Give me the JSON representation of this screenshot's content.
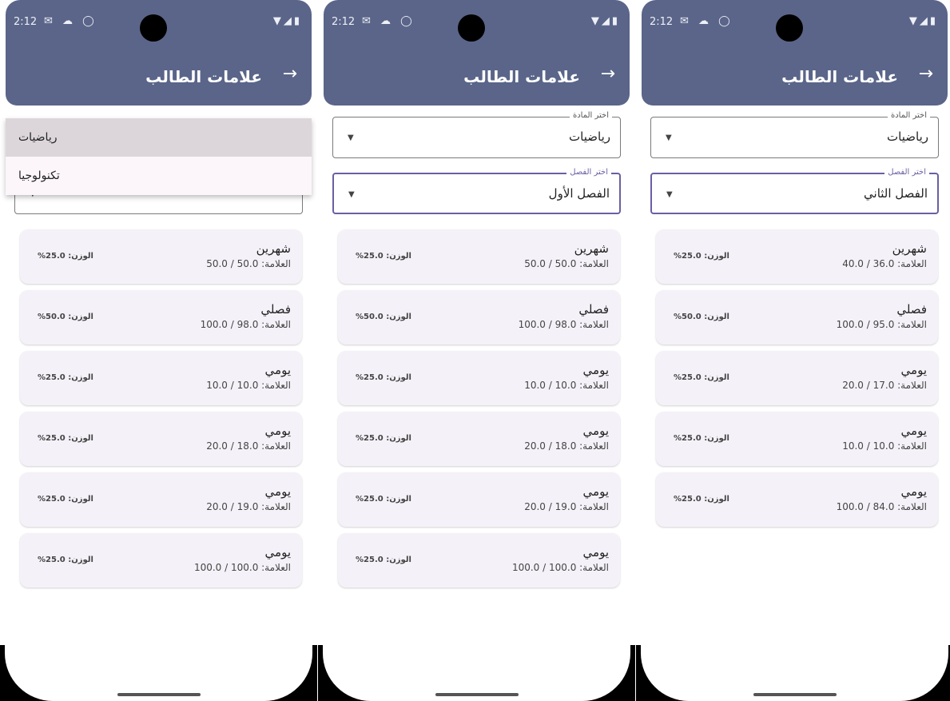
{
  "status": {
    "time": "2:12",
    "left_icons": "✉ ☁ ◯",
    "right_icons": "▼◢▮"
  },
  "screens": [
    {
      "title": "علامات الطالب",
      "subject_field": {
        "label": "",
        "value": ""
      },
      "semester_field": {
        "label": "",
        "value": ""
      },
      "dropdown_options": [
        "رياضيات",
        "تكنولوجيا"
      ],
      "cards": [
        {
          "title": "شهرين",
          "grade": "العلامة: 50.0 / 50.0",
          "weight": "الوزن: 25.0%"
        },
        {
          "title": "فصلي",
          "grade": "العلامة: 98.0 / 100.0",
          "weight": "الوزن: 50.0%"
        },
        {
          "title": "يومي",
          "grade": "العلامة: 10.0 / 10.0",
          "weight": "الوزن: 25.0%"
        },
        {
          "title": "يومي",
          "grade": "العلامة: 18.0 / 20.0",
          "weight": "الوزن: 25.0%"
        },
        {
          "title": "يومي",
          "grade": "العلامة: 19.0 / 20.0",
          "weight": "الوزن: 25.0%"
        },
        {
          "title": "يومي",
          "grade": "العلامة: 100.0 / 100.0",
          "weight": "الوزن: 25.0%"
        }
      ]
    },
    {
      "title": "علامات الطالب",
      "subject_field": {
        "label": "اختر المادة",
        "value": "رياضيات"
      },
      "semester_field": {
        "label": "اختر الفصل",
        "value": "الفصل الأول"
      },
      "cards": [
        {
          "title": "شهرين",
          "grade": "العلامة: 50.0 / 50.0",
          "weight": "الوزن: 25.0%"
        },
        {
          "title": "فصلي",
          "grade": "العلامة: 98.0 / 100.0",
          "weight": "الوزن: 50.0%"
        },
        {
          "title": "يومي",
          "grade": "العلامة: 10.0 / 10.0",
          "weight": "الوزن: 25.0%"
        },
        {
          "title": "يومي",
          "grade": "العلامة: 18.0 / 20.0",
          "weight": "الوزن: 25.0%"
        },
        {
          "title": "يومي",
          "grade": "العلامة: 19.0 / 20.0",
          "weight": "الوزن: 25.0%"
        },
        {
          "title": "يومي",
          "grade": "العلامة: 100.0 / 100.0",
          "weight": "الوزن: 25.0%"
        }
      ]
    },
    {
      "title": "علامات الطالب",
      "subject_field": {
        "label": "اختر المادة",
        "value": "رياضيات"
      },
      "semester_field": {
        "label": "اختر الفصل",
        "value": "الفصل الثاني"
      },
      "cards": [
        {
          "title": "شهرين",
          "grade": "العلامة: 36.0 / 40.0",
          "weight": "الوزن: 25.0%"
        },
        {
          "title": "فصلي",
          "grade": "العلامة: 95.0 / 100.0",
          "weight": "الوزن: 50.0%"
        },
        {
          "title": "يومي",
          "grade": "العلامة: 17.0 / 20.0",
          "weight": "الوزن: 25.0%"
        },
        {
          "title": "يومي",
          "grade": "العلامة: 10.0 / 10.0",
          "weight": "الوزن: 25.0%"
        },
        {
          "title": "يومي",
          "grade": "العلامة: 84.0 / 100.0",
          "weight": "الوزن: 25.0%"
        }
      ]
    }
  ]
}
